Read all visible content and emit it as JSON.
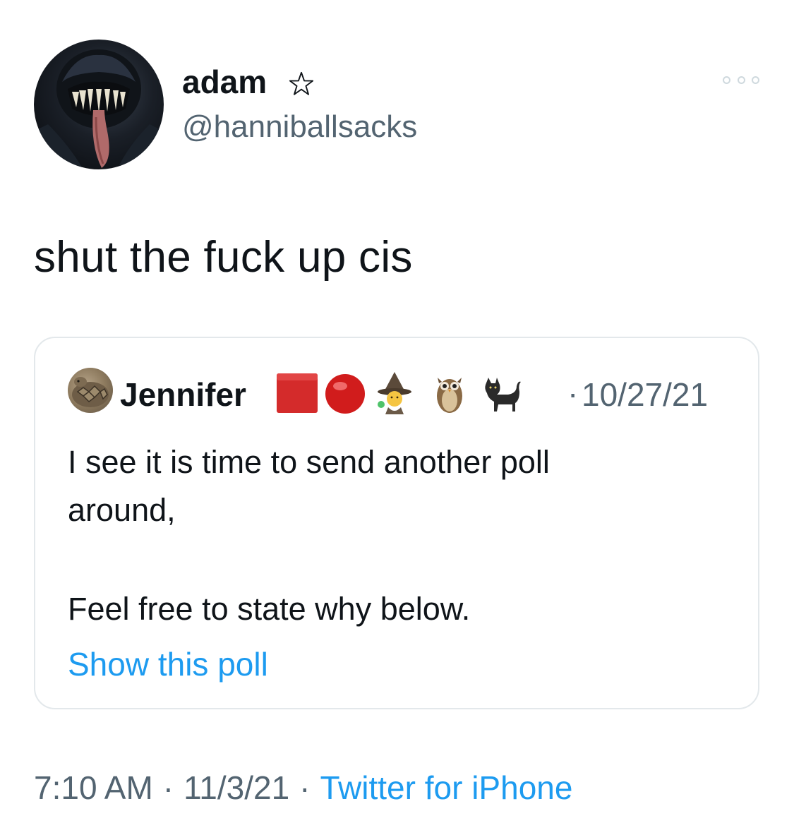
{
  "author": {
    "display_name": "adam",
    "badge_icon": "star-outline-icon",
    "handle": "@hanniballsacks",
    "avatar_icon": "venom-avatar"
  },
  "more_icon": "more-dots-icon",
  "tweet": {
    "text": "shut the fuck up cis"
  },
  "quoted": {
    "display_name": "Jennifer",
    "name_emojis": [
      "red-square-emoji",
      "red-circle-emoji",
      "mage-emoji",
      "owl-emoji",
      "black-cat-emoji"
    ],
    "separator": "·",
    "date": "10/27/21",
    "text_line1": "I see it is time to send another poll",
    "text_line2": "around,",
    "text_line3": "Feel free to state why below.",
    "show_poll_label": "Show this poll"
  },
  "footer": {
    "time": "7:10 AM",
    "dot1": "·",
    "date": "11/3/21",
    "dot2": "·",
    "source": "Twitter for iPhone"
  },
  "colors": {
    "link_blue": "#1d9bf0",
    "secondary_text": "#536471",
    "border": "#e3e8eb"
  }
}
